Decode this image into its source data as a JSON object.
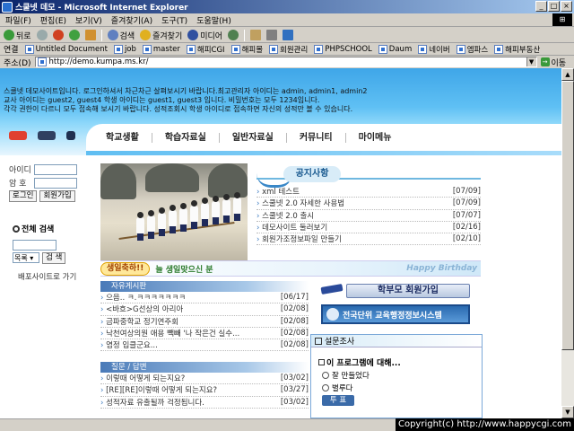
{
  "window": {
    "title": "스쿨넷 데모 - Microsoft Internet Explorer",
    "controls": [
      "_",
      "□",
      "×"
    ]
  },
  "menubar": [
    "파일(F)",
    "편집(E)",
    "보기(V)",
    "즐겨찾기(A)",
    "도구(T)",
    "도움말(H)"
  ],
  "toolbar": {
    "back": "뒤로",
    "search": "검색",
    "favorites": "즐겨찾기",
    "media": "미디어"
  },
  "links": {
    "label": "연결",
    "items": [
      "Untitled Document",
      "job",
      "master",
      "해피CGI",
      "해피몰",
      "회원관리",
      "PHPSCHOOL",
      "Daum",
      "네이버",
      "엠파스",
      "해피부동산"
    ]
  },
  "address": {
    "label": "주소(D)",
    "url": "http://demo.kumpa.ms.kr/",
    "go": "이동"
  },
  "header_notice": [
    "스쿨넷 데모사이트입니다. 로그인하셔서 차근차근 살펴보시기 바랍니다.최고관리자 아이디는 admin, admin1, admin2",
    "교사 아이디는 guest2, guest4 학생 아이디는 guest1, guest3 입니다. 비밀번호는 모두 1234입니다.",
    "각각 권한이 다르니 모두 접속해 보시기 바랍니다. 성적조회시 학생 아이디로 접속하면 자신의 성적만 볼 수 있습니다."
  ],
  "nav": [
    "학교생활",
    "학습자료실",
    "일반자료실",
    "커뮤니티",
    "마이메뉴"
  ],
  "login": {
    "id_label": "아이디",
    "pw_label": "암 호",
    "login_button": "로그인",
    "join_button": "회원가입"
  },
  "search": {
    "title": "전체 검색",
    "select_value": "목록",
    "button": "검 색"
  },
  "dist_link": "배포사이트로 가기",
  "notice_board": {
    "title": "공지사항",
    "rows": [
      {
        "title": "xml 테스트",
        "date": "[07/09]"
      },
      {
        "title": "스쿨넷 2.0 자세한 사용법",
        "date": "[07/09]"
      },
      {
        "title": "스쿨넷 2.0 출시",
        "date": "[07/07]"
      },
      {
        "title": "데모사이트 둘러보기",
        "date": "[02/16]"
      },
      {
        "title": "회원가조정보파일 만들기",
        "date": "[02/10]"
      }
    ]
  },
  "birthday": {
    "tag": "생일축하!!",
    "text": "늘 생일맞으신 분",
    "deco": "Happy Birthday"
  },
  "free_board": {
    "title": "자유게시판",
    "rows": [
      {
        "title": "으음.. ㅋ.ㅋㅋㅋㅋㅋㅋㅋ",
        "date": "[06/17]"
      },
      {
        "title": "<바흐>G선상의 아리아",
        "date": "[02/08]"
      },
      {
        "title": "금파중학교 정기연주회",
        "date": "[02/08]"
      },
      {
        "title": "낙천여상의원 애용 빽빼 '나 작은건 실수...",
        "date": "[02/08]"
      },
      {
        "title": "염정 입클군요...",
        "date": "[02/08]"
      }
    ]
  },
  "qa_board": {
    "title": "질문 / 답변",
    "rows": [
      {
        "title": "이렇때 어떻게 되는지요?",
        "date": "[03/02]"
      },
      {
        "title": "[RE][RE]이렇때 어떻게 되는지요?",
        "date": "[03/27]"
      },
      {
        "title": "성적자료 유출될까 걱정됩니다.",
        "date": "[03/02]"
      }
    ]
  },
  "right": {
    "parents_join": "학부모 회원가입",
    "edu_banner": "전국단위 교육행정정보시스템",
    "survey": {
      "title": "설문조사",
      "question": "이 프로그램에 대해...",
      "options": [
        "잘 만들었다",
        "별루다"
      ],
      "vote": "투 표"
    }
  },
  "copyright": "Copyright(c) http://www.happycgi.com"
}
